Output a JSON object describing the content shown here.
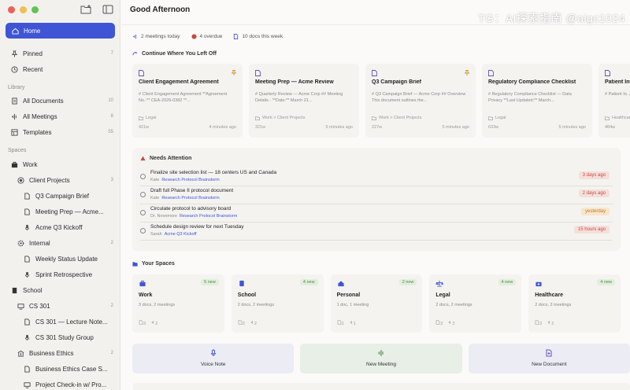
{
  "header": {
    "title": "Good Afternoon",
    "watermark": "TG：AI探索指南 @aigc1024"
  },
  "sidebar": {
    "home": "Home",
    "pinned": {
      "label": "Pinned",
      "count": "7"
    },
    "recent": "Recent",
    "library_label": "Library",
    "all_documents": {
      "label": "All Documents",
      "count": "10"
    },
    "all_meetings": {
      "label": "All Meetings",
      "count": "8"
    },
    "templates": {
      "label": "Templates",
      "count": "55"
    },
    "spaces_label": "Spaces",
    "work": "Work",
    "client_projects": {
      "label": "Client Projects",
      "count": "3"
    },
    "q3_campaign": "Q3 Campaign Brief",
    "meeting_prep": "Meeting Prep — Acme...",
    "acme_kickoff": "Acme Q3 Kickoff",
    "internal": {
      "label": "Internal",
      "count": "2"
    },
    "weekly_status": "Weekly Status Update",
    "sprint_retro": "Sprint Retrospective",
    "school": "School",
    "cs301": {
      "label": "CS 301",
      "count": "2"
    },
    "cs301_lecture": "CS 301 — Lecture Note...",
    "cs301_study": "CS 301 Study Group",
    "business_ethics": {
      "label": "Business Ethics",
      "count": "2"
    },
    "ethics_case": "Business Ethics Case S...",
    "project_checkin": "Project Check-in w/ Pro..."
  },
  "stats": {
    "meetings": "2 meetings today",
    "overdue": "4 overdue",
    "docs": "10 docs this week"
  },
  "continue_label": "Continue Where You Left Off",
  "recent_docs": [
    {
      "title": "Client Engagement Agreement",
      "snippet": "# Client Engagement Agreement **Agreement No.:** CEA-2026-0382 **...",
      "path": "Legal",
      "words": "421w",
      "time": "4 minutes ago"
    },
    {
      "title": "Meeting Prep — Acme Review",
      "snippet": "# Quarterly Review — Acme Corp ## Meeting Details - **Date:** March 21...",
      "path": "Work > Client Projects",
      "words": "321w",
      "time": "5 minutes ago"
    },
    {
      "title": "Q3 Campaign Brief",
      "snippet": "# Q3 Campaign Brief — Acme Corp ## Overview This document outlines the...",
      "path": "Work > Client Projects",
      "words": "227w",
      "time": "5 minutes ago"
    },
    {
      "title": "Regulatory Compliance Checklist",
      "snippet": "# Regulatory Compliance Checklist — Data Privacy **Last Updated:** March...",
      "path": "Legal",
      "words": "633w",
      "time": "5 minutes ago"
    },
    {
      "title": "Patient Int...",
      "snippet": "# Patient In...",
      "path": "Healthcare",
      "words": "484w",
      "time": ""
    }
  ],
  "attention": {
    "label": "Needs Attention",
    "items": [
      {
        "title": "Finalize site selection list — 18 centers US and Canada",
        "who": "Kate",
        "link": "Research Protocol Brainstorm",
        "due": "3 days ago"
      },
      {
        "title": "Draft full Phase II protocol document",
        "who": "Kate",
        "link": "Research Protocol Brainstorm",
        "due": "2 days ago"
      },
      {
        "title": "Circulate protocol to advisory board",
        "who": "Dr. Novemore",
        "link": "Research Protocol Brainstorm",
        "due": "yesterday"
      },
      {
        "title": "Schedule design review for next Tuesday",
        "who": "Sarah",
        "link": "Acme Q3 Kickoff",
        "due": "15 hours ago"
      }
    ]
  },
  "spaces_label": "Your Spaces",
  "spaces": [
    {
      "name": "Work",
      "new": "5 new",
      "stats": "3 docs, 2 meetings",
      "f1": "3",
      "f2": "2"
    },
    {
      "name": "School",
      "new": "4 new",
      "stats": "2 docs, 2 meetings",
      "f1": "2",
      "f2": "2"
    },
    {
      "name": "Personal",
      "new": "2 new",
      "stats": "1 doc, 1 meeting",
      "f1": "1",
      "f2": "1"
    },
    {
      "name": "Legal",
      "new": "4 new",
      "stats": "2 docs, 2 meetings",
      "f1": "2",
      "f2": "2"
    },
    {
      "name": "Healthcare",
      "new": "4 new",
      "stats": "2 docs, 2 meetings",
      "f1": "2",
      "f2": "2"
    }
  ],
  "actions": {
    "voice": "Voice Note",
    "meeting": "New Meeting",
    "document": "New Document"
  },
  "colors": {
    "accent": "#3f55d6",
    "overdue": "#c74a3e",
    "new_badge": "#4d8a4a"
  }
}
